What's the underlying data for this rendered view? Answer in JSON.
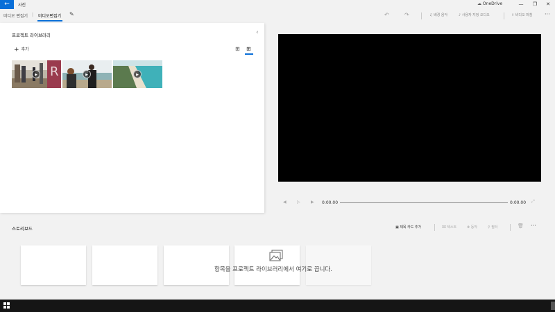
{
  "titlebar": {
    "back_icon": "←",
    "app_title": "사진",
    "onedrive_label": "OneDrive",
    "minimize": "—",
    "maximize": "❐",
    "close": "✕"
  },
  "toolbar": {
    "crumb_parent": "비디오 편집기",
    "crumb_current": "비디오편집기",
    "edit_icon": "✎",
    "undo_icon": "↶",
    "redo_icon": "↷",
    "background_music": "배경 음악",
    "custom_audio": "사용자 지정 오디오",
    "finish_video": "비디오 마침",
    "more": "···"
  },
  "library": {
    "title": "프로젝트 라이브러리",
    "collapse_icon": "‹",
    "add_label": "추가",
    "add_icon": "+",
    "grid_small_icon": "⊞",
    "grid_large_icon": "⊞",
    "play_icon": "▶"
  },
  "player": {
    "rewind_icon": "◀",
    "play_icon": "▷",
    "forward_icon": "▶",
    "current_time": "0:00.00",
    "end_time": "0:00.00",
    "fullscreen_icon": "⤢",
    "progress": 0
  },
  "storyboard": {
    "title": "스토리보드",
    "title_card": "제목 카드 추가",
    "text": "텍스트",
    "motion": "동작",
    "filters": "필터",
    "delete_icon": "🗑",
    "more": "···",
    "drop_message": "항목을 프로젝트 라이브러리에서 여기로 끕니다."
  },
  "colors": {
    "accent": "#0a6fd8",
    "preview_bg": "#000000",
    "taskbar": "#151515"
  }
}
